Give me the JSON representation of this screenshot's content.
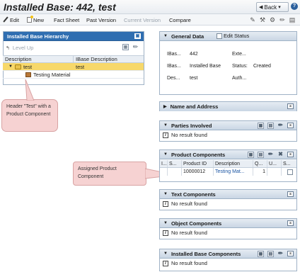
{
  "page": {
    "title": "Installed Base: 442, test",
    "back_label": "Back",
    "help_label": "?"
  },
  "toolbar": {
    "edit": "Edit",
    "new": "New",
    "fact_sheet": "Fact Sheet",
    "past_version": "Past Version",
    "current_version": "Current Version",
    "compare": "Compare"
  },
  "hierarchy": {
    "title": "Installed Base Hierarchy",
    "level_up": "Level Up",
    "columns": [
      "Description",
      "IBase Description"
    ],
    "rows": [
      {
        "description": "test",
        "ibase": "test"
      },
      {
        "description": "Testing Material",
        "ibase": ""
      }
    ]
  },
  "callouts": {
    "header": "Header \"Test\" with a Product Component",
    "assigned": "Assigned Product Component"
  },
  "general_data": {
    "title": "General Data",
    "edit_status": "Edit Status",
    "fields": [
      {
        "label": "IBas...",
        "value": "442"
      },
      {
        "label": "IBas...",
        "value": "Installed Base"
      },
      {
        "label": "Des...",
        "value": "test"
      }
    ],
    "right_fields": [
      {
        "label": "Exte...",
        "value": ""
      },
      {
        "label": "Status:",
        "value": "Created"
      },
      {
        "label": "Auth...",
        "value": ""
      }
    ]
  },
  "name_address": {
    "title": "Name and Address"
  },
  "parties": {
    "title": "Parties Involved",
    "empty": "No result found"
  },
  "product_components": {
    "title": "Product Components",
    "columns": [
      "I...",
      "S...",
      "Product ID",
      "Description",
      "Q...",
      "U...",
      "S..."
    ],
    "rows": [
      {
        "i": "",
        "s": "",
        "product_id": "10000012",
        "description": "Testing Mat...",
        "q": "1",
        "u": "",
        "s2": ""
      }
    ]
  },
  "text_components": {
    "title": "Text Components",
    "empty": "No result found"
  },
  "object_components": {
    "title": "Object Components",
    "empty": "No result found"
  },
  "installed_base_components": {
    "title": "Installed Base Components",
    "empty": "No result found"
  }
}
